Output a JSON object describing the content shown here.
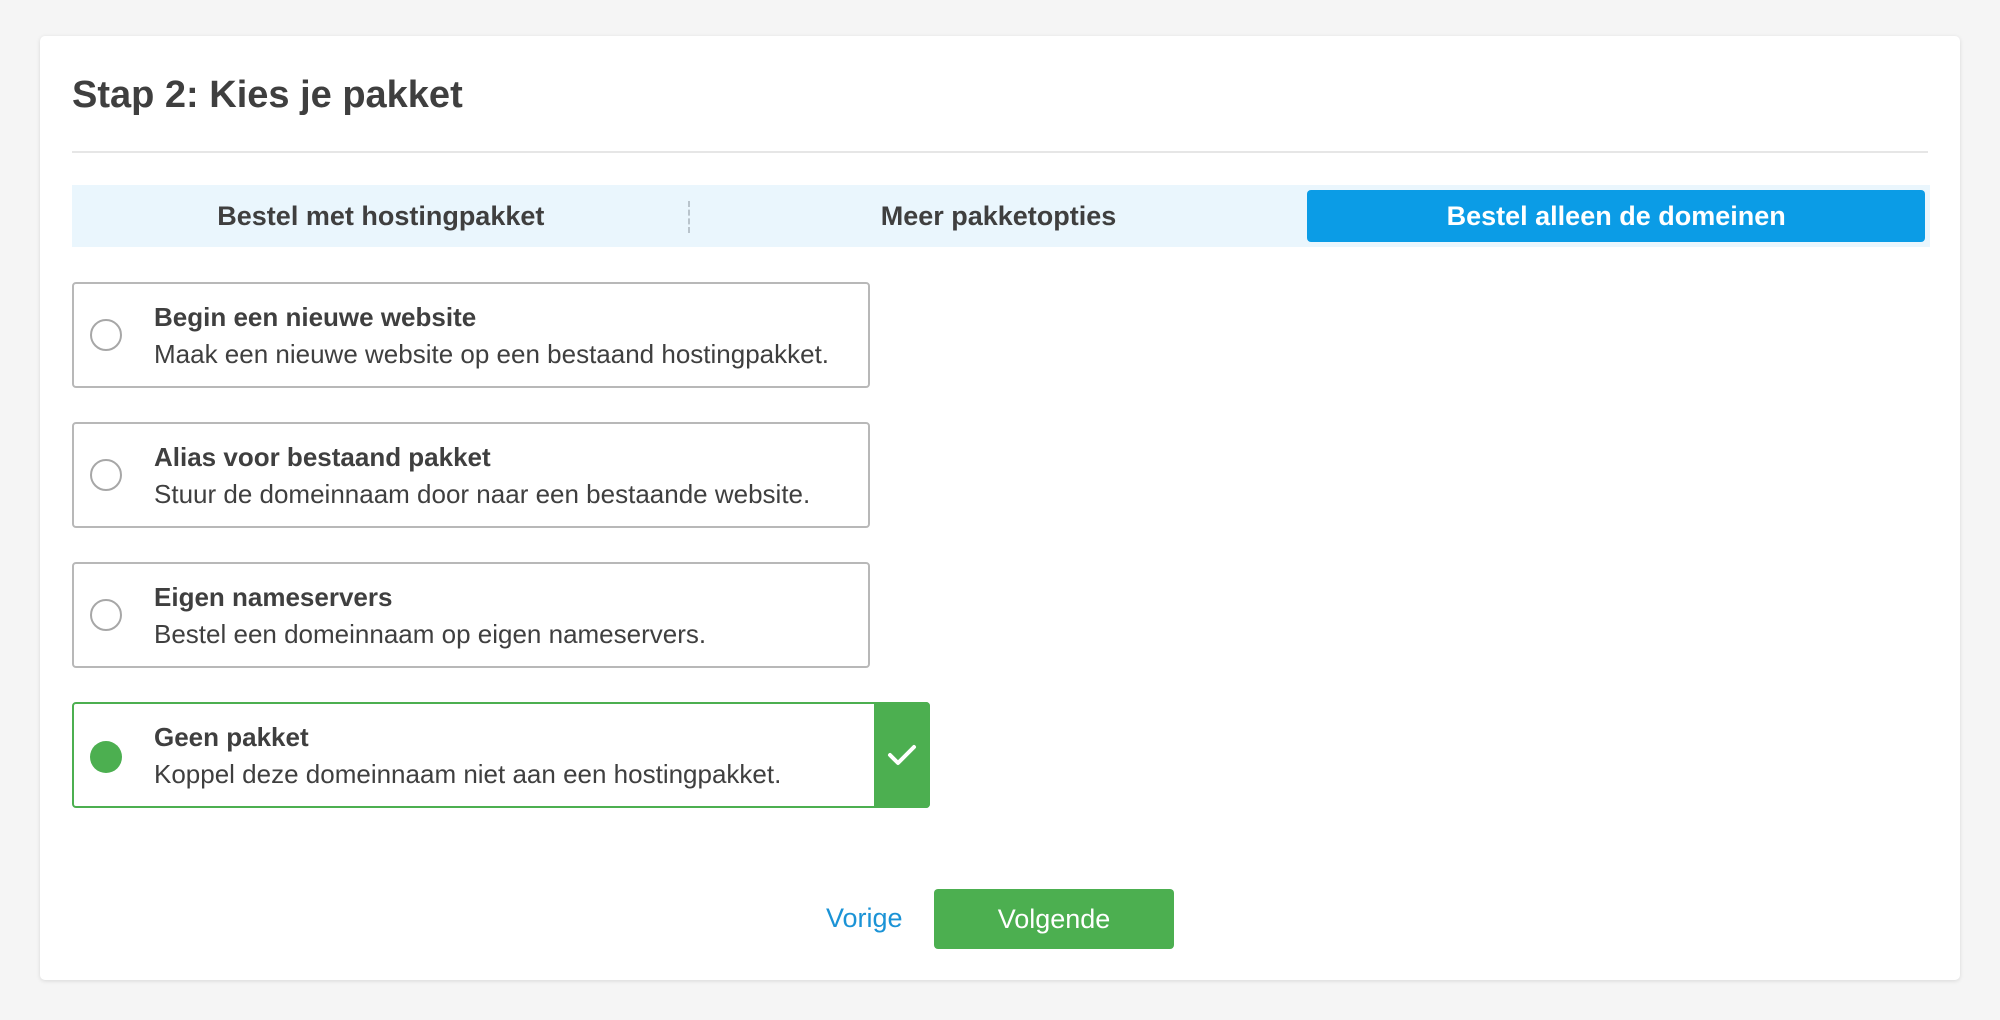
{
  "page": {
    "title": "Stap 2: Kies je pakket"
  },
  "tabs": [
    {
      "label": "Bestel met hostingpakket",
      "active": false
    },
    {
      "label": "Meer pakketopties",
      "active": false
    },
    {
      "label": "Bestel alleen de domeinen",
      "active": true
    }
  ],
  "options": [
    {
      "title": "Begin een nieuwe website",
      "description": "Maak een nieuwe website op een bestaand hostingpakket.",
      "selected": false
    },
    {
      "title": "Alias voor bestaand pakket",
      "description": "Stuur de domeinnaam door naar een bestaande website.",
      "selected": false
    },
    {
      "title": "Eigen nameservers",
      "description": "Bestel een domeinnaam op eigen nameservers.",
      "selected": false
    },
    {
      "title": "Geen pakket",
      "description": "Koppel deze domeinnaam niet aan een hostingpakket.",
      "selected": true
    }
  ],
  "navigation": {
    "prev_label": "Vorige",
    "next_label": "Volgende"
  },
  "colors": {
    "accent_blue": "#0b9ce6",
    "success_green": "#4caf50",
    "tab_background": "#eaf6fd",
    "link_blue": "#1b93d6"
  },
  "icons": {
    "selected_indicator": "check-icon"
  }
}
